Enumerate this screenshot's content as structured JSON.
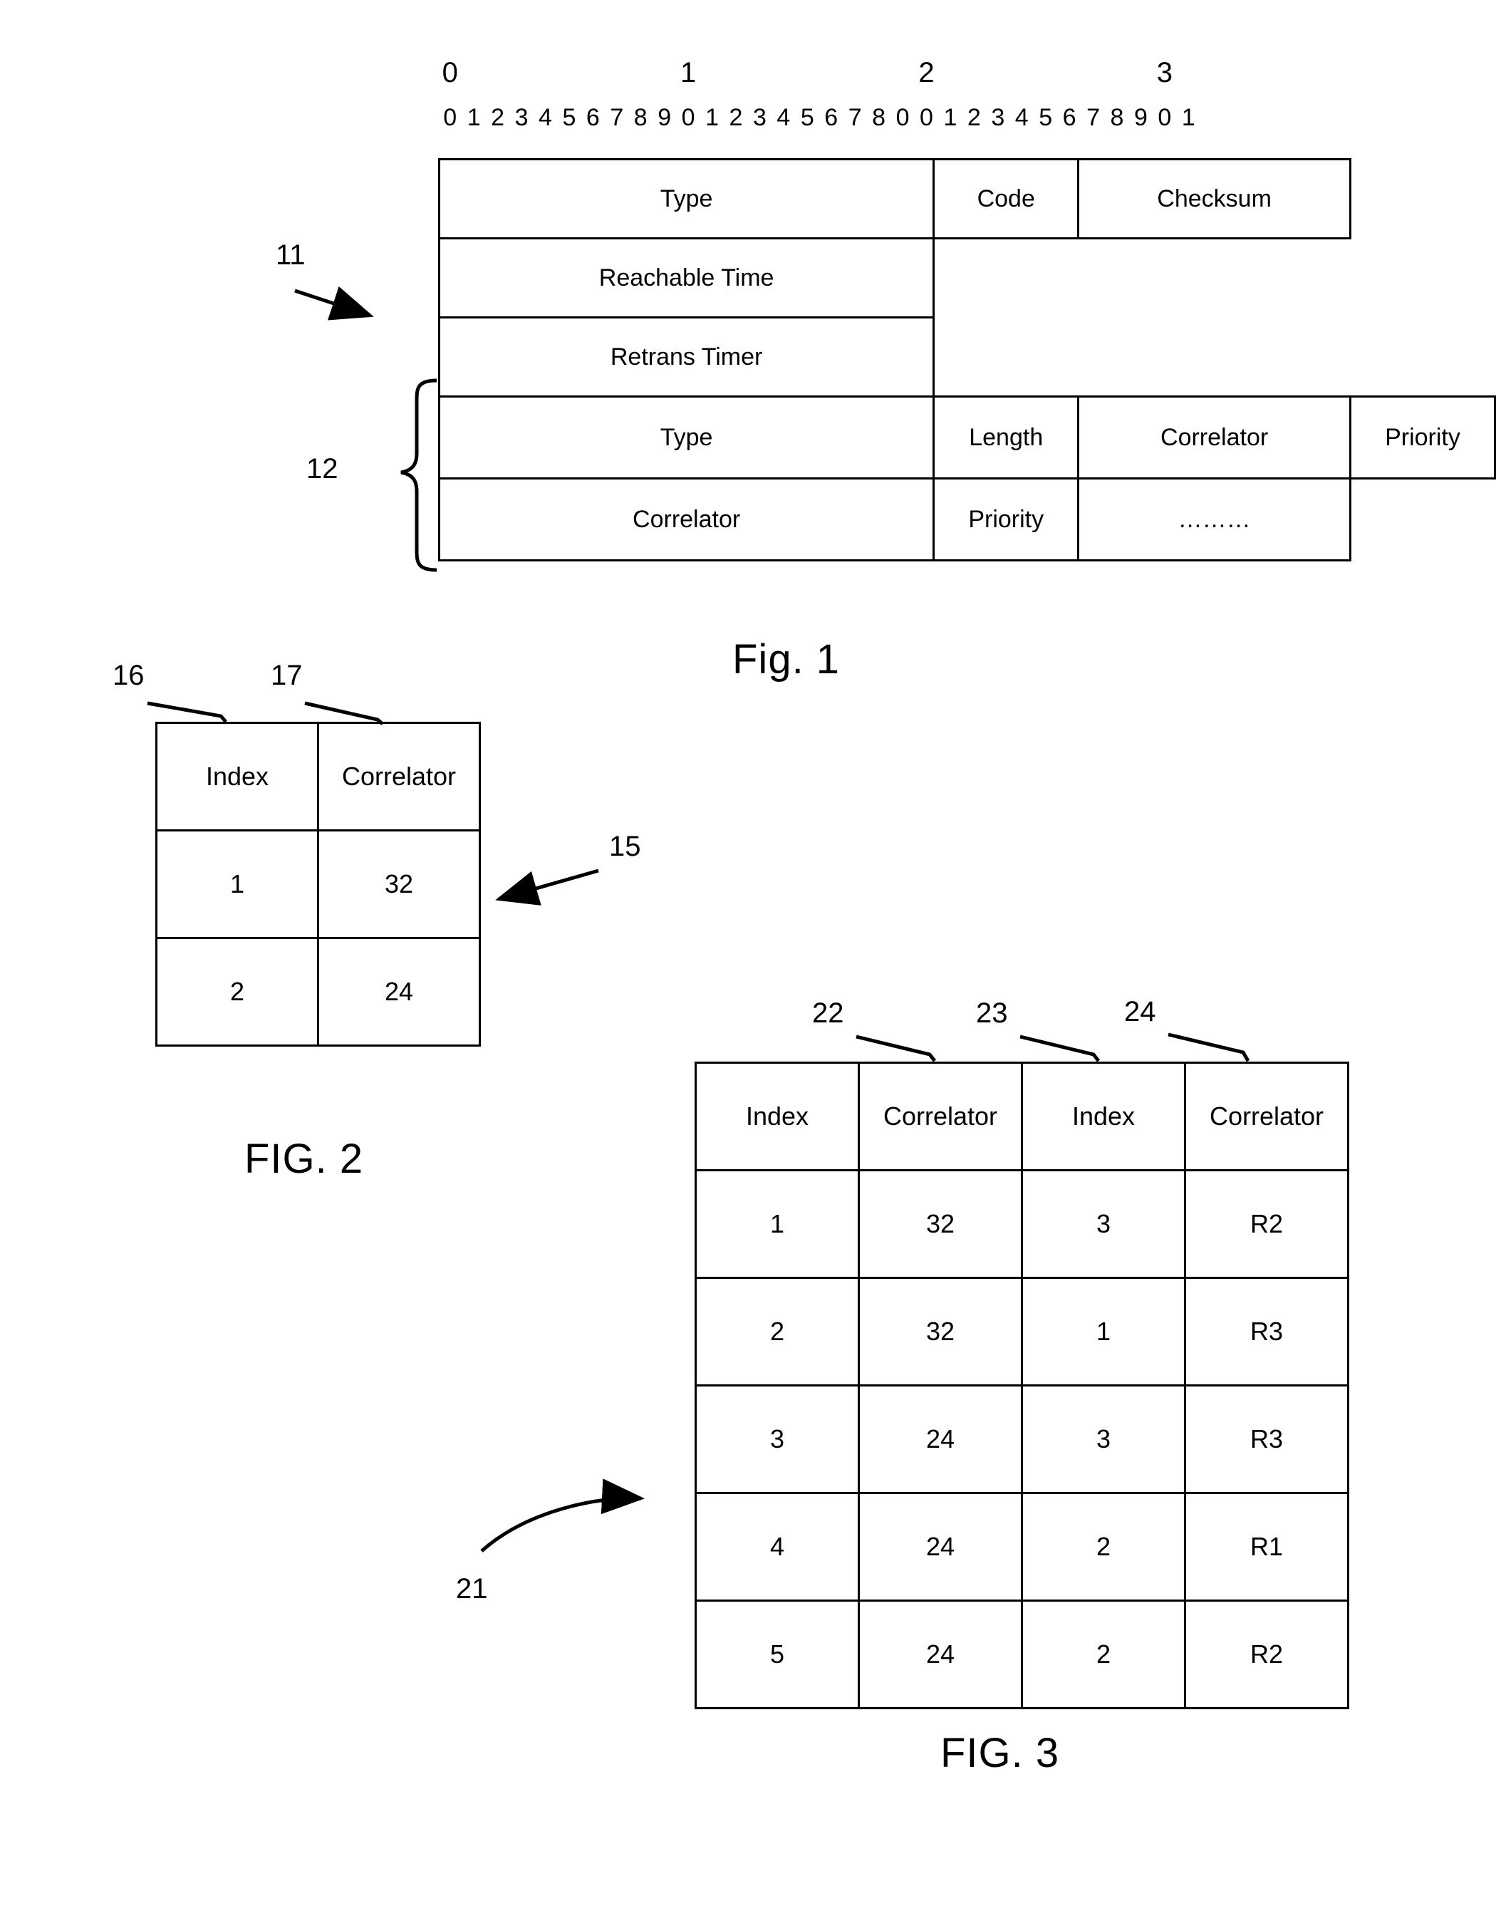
{
  "figure1": {
    "bit_ruler": {
      "decade_labels": [
        "0",
        "1",
        "2",
        "3"
      ],
      "bit_labels": [
        "0",
        "1",
        "2",
        "3",
        "4",
        "5",
        "6",
        "7",
        "8",
        "9",
        "0",
        "1",
        "2",
        "3",
        "4",
        "5",
        "6",
        "7",
        "8",
        "0",
        "0",
        "1",
        "2",
        "3",
        "4",
        "5",
        "6",
        "7",
        "8",
        "9",
        "0",
        "1"
      ]
    },
    "rows": [
      {
        "cells": [
          {
            "label": "Type",
            "span": 8
          },
          {
            "label": "Code",
            "span": 8
          },
          {
            "label": "Checksum",
            "span": 16
          }
        ]
      },
      {
        "cells": [
          {
            "label": "Reachable Time",
            "span": 32
          }
        ]
      },
      {
        "cells": [
          {
            "label": "Retrans Timer",
            "span": 32
          }
        ]
      },
      {
        "cells": [
          {
            "label": "Type",
            "span": 8
          },
          {
            "label": "Length",
            "span": 8
          },
          {
            "label": "Correlator",
            "span": 8
          },
          {
            "label": "Priority",
            "span": 8
          }
        ]
      },
      {
        "cells": [
          {
            "label": "Correlator",
            "span": 8
          },
          {
            "label": "Priority",
            "span": 8
          },
          {
            "label": "………",
            "span": 8
          }
        ]
      }
    ],
    "reference_numerals": [
      {
        "id": "11",
        "text": "11"
      },
      {
        "id": "12",
        "text": "12"
      }
    ],
    "caption": "Fig. 1"
  },
  "figure2": {
    "caption": "FIG. 2",
    "headers": [
      "Index",
      "Correlator"
    ],
    "rows": [
      [
        "1",
        "32"
      ],
      [
        "2",
        "24"
      ]
    ],
    "reference_numerals": [
      {
        "id": "16",
        "text": "16"
      },
      {
        "id": "17",
        "text": "17"
      },
      {
        "id": "15",
        "text": "15"
      }
    ]
  },
  "figure3": {
    "caption": "FIG. 3",
    "headers": [
      "Index",
      "Correlator",
      "Index",
      "Correlator"
    ],
    "rows": [
      [
        "1",
        "32",
        "3",
        "R2"
      ],
      [
        "2",
        "32",
        "1",
        "R3"
      ],
      [
        "3",
        "24",
        "3",
        "R3"
      ],
      [
        "4",
        "24",
        "2",
        "R1"
      ],
      [
        "5",
        "24",
        "2",
        "R2"
      ]
    ],
    "reference_numerals": [
      {
        "id": "22",
        "text": "22"
      },
      {
        "id": "23",
        "text": "23"
      },
      {
        "id": "24",
        "text": "24"
      },
      {
        "id": "21",
        "text": "21"
      }
    ]
  },
  "colors": {
    "ink": "#000000",
    "paper": "#ffffff"
  }
}
